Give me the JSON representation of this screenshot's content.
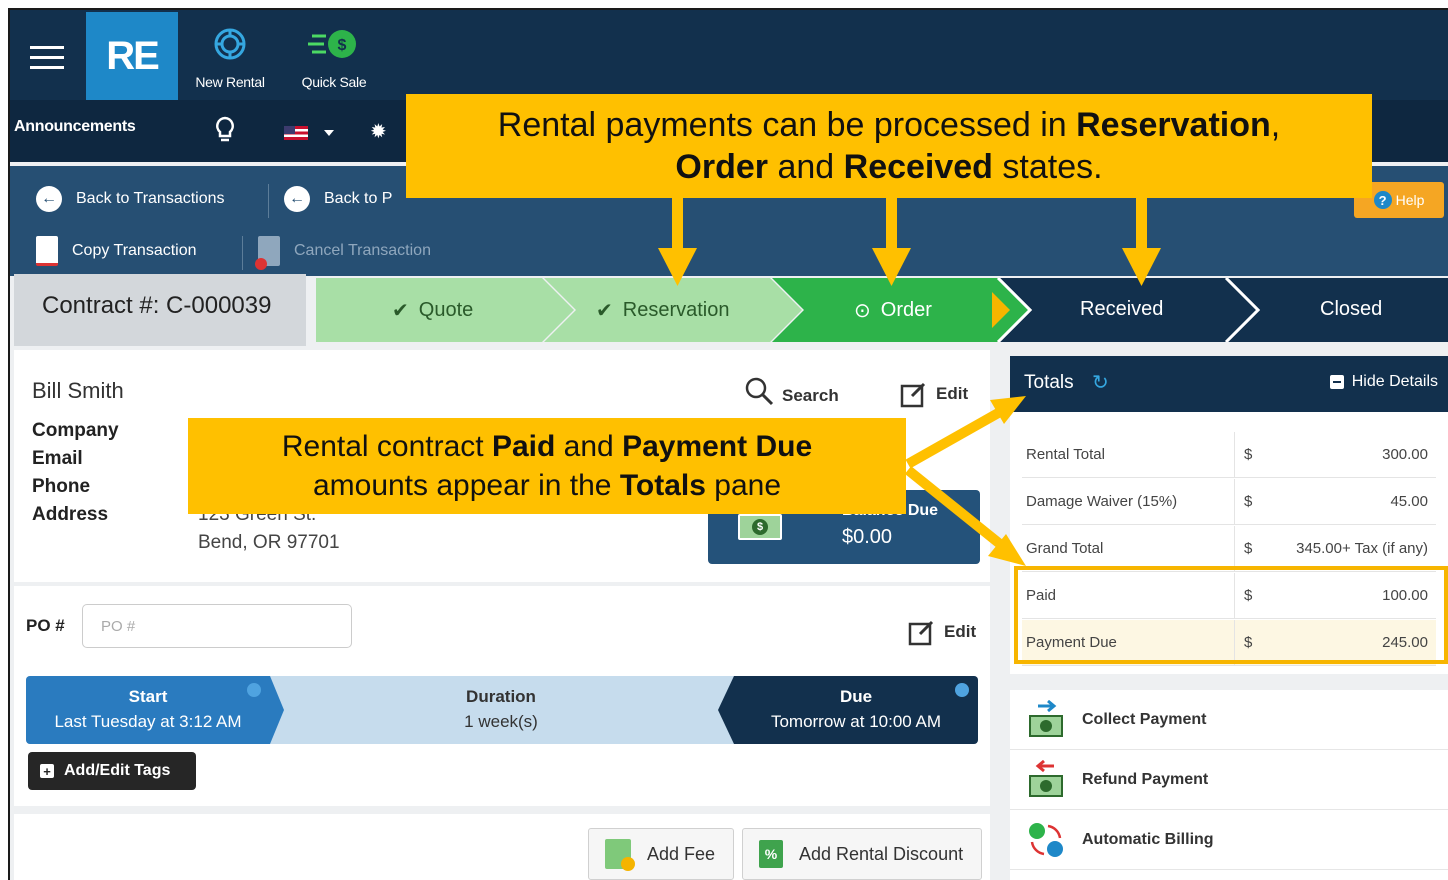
{
  "topbar": {
    "logo": "RE",
    "new_rental": "New Rental",
    "quick_sale": "Quick Sale",
    "announcements": "Announcements"
  },
  "actions": {
    "back_to_transactions": "Back to Transactions",
    "back_to_p": "Back to P",
    "copy_transaction": "Copy Transaction",
    "cancel_transaction": "Cancel Transaction",
    "help": "Help"
  },
  "contract": {
    "number": "Contract #: C-000039"
  },
  "steps": [
    {
      "label": "Quote",
      "state": "done"
    },
    {
      "label": "Reservation",
      "state": "done"
    },
    {
      "label": "Order",
      "state": "current"
    },
    {
      "label": "Received",
      "state": "pending"
    },
    {
      "label": "Closed",
      "state": "pending"
    }
  ],
  "customer": {
    "name": "Bill Smith",
    "search": "Search",
    "edit": "Edit",
    "labels": {
      "company": "Company",
      "email": "Email",
      "phone": "Phone",
      "address": "Address"
    },
    "address_line1": "123 Green St.",
    "address_line2": "Bend, OR 97701"
  },
  "balance": {
    "label": "Balance Due",
    "amount": "$0.00"
  },
  "po": {
    "label": "PO #",
    "placeholder": "PO #",
    "edit": "Edit"
  },
  "timeline": {
    "start_label": "Start",
    "start_value": "Last Tuesday at 3:12 AM",
    "duration_label": "Duration",
    "duration_value": "1 week(s)",
    "due_label": "Due",
    "due_value": "Tomorrow at 10:00 AM"
  },
  "tags_button": "Add/Edit Tags",
  "fee_button": "Add Fee",
  "discount_button": "Add Rental Discount",
  "totals": {
    "title": "Totals",
    "hide": "Hide Details",
    "rows": [
      {
        "label": "Rental Total",
        "currency": "$",
        "value": "300.00"
      },
      {
        "label": "Damage Waiver (15%)",
        "currency": "$",
        "value": "45.00"
      },
      {
        "label": "Grand Total",
        "currency": "$",
        "value": "345.00+ Tax (if any)"
      },
      {
        "label": "Paid",
        "currency": "$",
        "value": "100.00"
      },
      {
        "label": "Payment Due",
        "currency": "$",
        "value": "245.00"
      }
    ]
  },
  "payment_actions": {
    "collect": "Collect Payment",
    "refund": "Refund Payment",
    "automatic": "Automatic Billing"
  },
  "callouts": {
    "top_line1_a": "Rental payments can be processed in ",
    "top_line1_b": "Reservation",
    "top_line1_c": ",",
    "top_line2_a": "Order",
    "top_line2_b": " and ",
    "top_line2_c": "Received",
    "top_line2_d": " states.",
    "mid_line1_a": "Rental contract ",
    "mid_line1_b": "Paid",
    "mid_line1_c": " and ",
    "mid_line1_d": "Payment Due",
    "mid_line2_a": "amounts appear in the ",
    "mid_line2_b": "Totals",
    "mid_line2_c": " pane"
  },
  "colors": {
    "navy": "#12304d",
    "blue": "#1e88c8",
    "green_done": "#a8dfa6",
    "green_current": "#2db34a",
    "callout": "#ffc000"
  }
}
